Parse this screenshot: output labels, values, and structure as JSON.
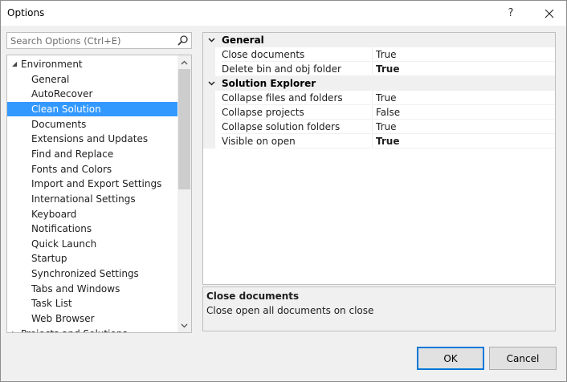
{
  "window": {
    "title": "Options",
    "help_label": "?"
  },
  "search": {
    "placeholder": "Search Options (Ctrl+E)",
    "value": ""
  },
  "tree": {
    "items": [
      {
        "label": "Environment",
        "level": 0,
        "expanded": true
      },
      {
        "label": "General",
        "level": 1
      },
      {
        "label": "AutoRecover",
        "level": 1
      },
      {
        "label": "Clean Solution",
        "level": 1,
        "selected": true
      },
      {
        "label": "Documents",
        "level": 1
      },
      {
        "label": "Extensions and Updates",
        "level": 1
      },
      {
        "label": "Find and Replace",
        "level": 1
      },
      {
        "label": "Fonts and Colors",
        "level": 1
      },
      {
        "label": "Import and Export Settings",
        "level": 1
      },
      {
        "label": "International Settings",
        "level": 1
      },
      {
        "label": "Keyboard",
        "level": 1
      },
      {
        "label": "Notifications",
        "level": 1
      },
      {
        "label": "Quick Launch",
        "level": 1
      },
      {
        "label": "Startup",
        "level": 1
      },
      {
        "label": "Synchronized Settings",
        "level": 1
      },
      {
        "label": "Tabs and Windows",
        "level": 1
      },
      {
        "label": "Task List",
        "level": 1
      },
      {
        "label": "Web Browser",
        "level": 1
      },
      {
        "label": "Projects and Solutions",
        "level": 0,
        "expanded": false
      }
    ]
  },
  "properties": {
    "categories": [
      {
        "name": "General",
        "rows": [
          {
            "name": "Close documents",
            "value": "True",
            "bold": false
          },
          {
            "name": "Delete bin and obj folder",
            "value": "True",
            "bold": true
          }
        ]
      },
      {
        "name": "Solution Explorer",
        "rows": [
          {
            "name": "Collapse files and folders",
            "value": "True",
            "bold": false
          },
          {
            "name": "Collapse projects",
            "value": "False",
            "bold": false
          },
          {
            "name": "Collapse solution folders",
            "value": "True",
            "bold": false
          },
          {
            "name": "Visible on open",
            "value": "True",
            "bold": true
          }
        ]
      }
    ]
  },
  "description": {
    "title": "Close documents",
    "text": "Close open all documents on close"
  },
  "buttons": {
    "ok": "OK",
    "cancel": "Cancel"
  },
  "colors": {
    "selection": "#3399ff",
    "ok_border": "#0078d7"
  },
  "icons": {
    "search": "search-icon",
    "close": "close-icon",
    "expand": "caret-down-icon",
    "collapse": "caret-right-icon"
  }
}
